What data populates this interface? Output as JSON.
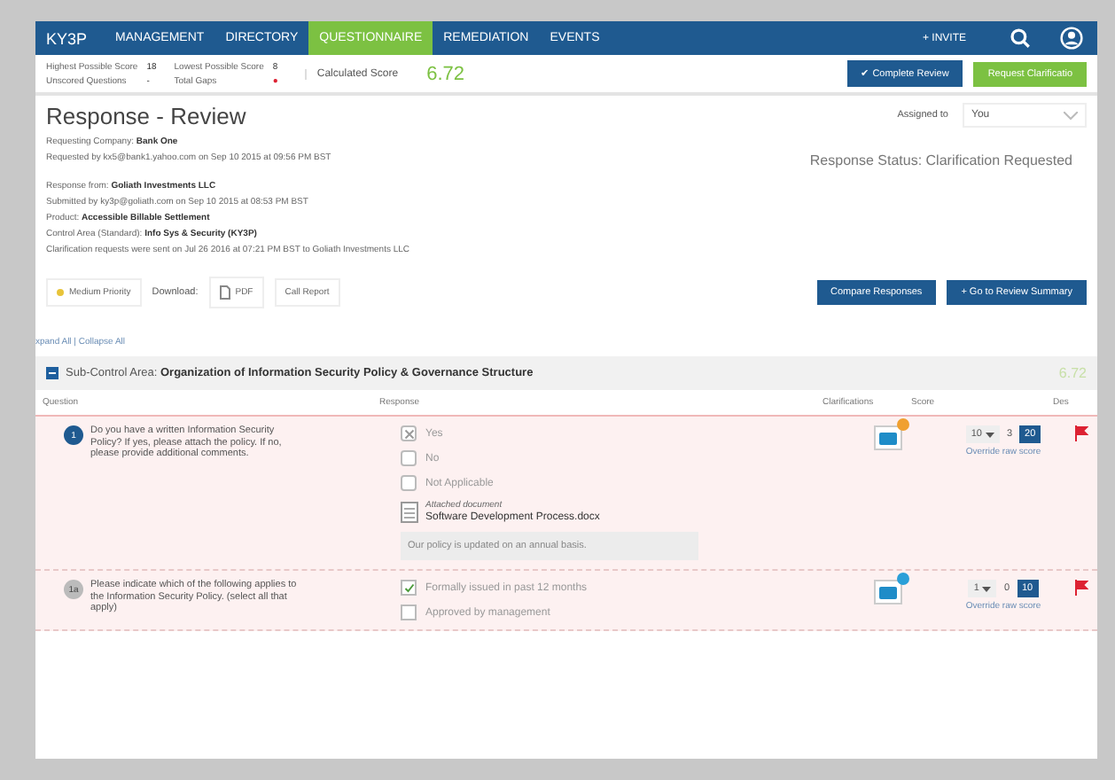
{
  "nav": {
    "logo": "KY3P",
    "items": [
      {
        "label": "MANAGEMENT",
        "selected": false
      },
      {
        "label": "DIRECTORY",
        "selected": false
      },
      {
        "label": "QUESTIONNAIRE",
        "selected": true
      },
      {
        "label": "REMEDIATION",
        "selected": false
      },
      {
        "label": "EVENTS",
        "selected": false
      }
    ],
    "invite": "+ INVITE"
  },
  "score_bar": {
    "stats": [
      {
        "label": "Highest Possible Score",
        "value": "18"
      },
      {
        "label": "Lowest Possible Score",
        "value": "8"
      },
      {
        "label": "Unscored Questions",
        "value": "-"
      },
      {
        "label": "Total Gaps",
        "value": "●"
      }
    ],
    "calculated_label": "Calculated Score",
    "calculated": "6.72",
    "complete_button": "✔ Complete Review",
    "clarify_button": "Request Clarificatio"
  },
  "header": {
    "title": "Response - Review",
    "assigned_label": "Assigned to",
    "assigned": "You",
    "status": "Response Status: Clarification Requested",
    "lines": [
      "Requesting Company: **Bank One**",
      "Requested by kx5@bank1.yahoo.com on Sep 10 2015 at 09:56 PM BST",
      "Response from: **Goliath Investments LLC**",
      "Submitted by ky3p@goliath.com on Sep 10 2015 at 08:53 PM BST",
      "Product: **Accessible Billable Settlement**",
      "Control Area (Standard): **Info Sys & Security (KY3P)**",
      "Clarification requests were sent on Jul 26 2016 at 07:21 PM BST to Goliath Investments LLC"
    ]
  },
  "toolbar": {
    "priority": {
      "label": "Medium Priority",
      "color": "#e8c43a"
    },
    "download": "Download:",
    "pdf": "PDF",
    "call_report": "Call Report",
    "compare": "Compare Responses",
    "summary": "+ Go to Review Summary"
  },
  "expand": "xpand All | Collapse All",
  "section": {
    "prefix": "Sub-Control Area:",
    "title": "Organization of Information Security Policy & Governance Structure",
    "score": "6.72",
    "expanded": true
  },
  "columns": [
    "Question",
    "Response",
    "Clarifications",
    "Score",
    "Des"
  ],
  "rows": [
    {
      "number": "1",
      "primary": true,
      "question": "Do you have a written Information Security Policy? If yes, please attach the policy. If no, please provide additional comments.",
      "options": [
        {
          "kind": "radio",
          "label": "Yes",
          "checked": true
        },
        {
          "kind": "radio",
          "label": "No",
          "checked": false
        },
        {
          "kind": "radio",
          "label": "Not Applicable",
          "checked": false
        }
      ],
      "attachment": {
        "label": "Attached document",
        "file": "Software Development Process.docx"
      },
      "comment": "Our policy is updated on an annual basis.",
      "clarification_badge": {
        "color": "#f0a030"
      },
      "score": "10",
      "gap": "3",
      "max": "20",
      "override": "Override raw score"
    },
    {
      "number": "1a",
      "primary": false,
      "question": "Please indicate which of the following applies to the Information Security Policy. (select all that apply)",
      "options": [
        {
          "kind": "checkbox",
          "label": "Formally issued in past 12 months",
          "checked": true
        },
        {
          "kind": "checkbox",
          "label": "Approved by management",
          "checked": false
        }
      ],
      "clarification_badge": {
        "color": "#2a9fd8"
      },
      "score": "1",
      "gap": "0",
      "max": "10",
      "override": "Override raw score"
    }
  ]
}
